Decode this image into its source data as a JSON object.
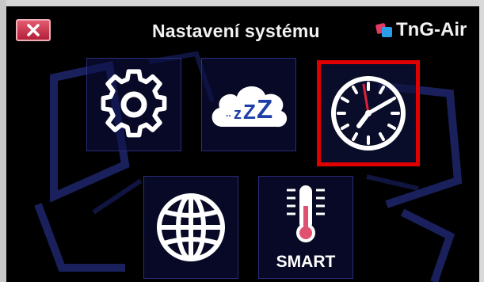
{
  "header": {
    "title": "Nastavení systému",
    "brand": "TnG-Air",
    "close_icon": "close-x-icon"
  },
  "menu": {
    "tiles": [
      {
        "id": "general-settings",
        "icon": "gear-icon",
        "selected": false
      },
      {
        "id": "sleep",
        "icon": "sleep-cloud-icon",
        "icon_text": "..zZZ",
        "selected": false
      },
      {
        "id": "clock",
        "icon": "clock-icon",
        "selected": true
      },
      {
        "id": "language",
        "icon": "globe-icon",
        "selected": false
      },
      {
        "id": "smart-temperature",
        "icon": "thermometer-icon",
        "label": "SMART",
        "selected": false
      }
    ]
  },
  "colors": {
    "selection": "#e00000",
    "close_button": "#c8304a",
    "clock_second_hand": "#e0203a",
    "thermometer_bulb": "#e05070",
    "brand_icon_blue": "#2a9fe8",
    "brand_icon_red": "#e03a60"
  }
}
